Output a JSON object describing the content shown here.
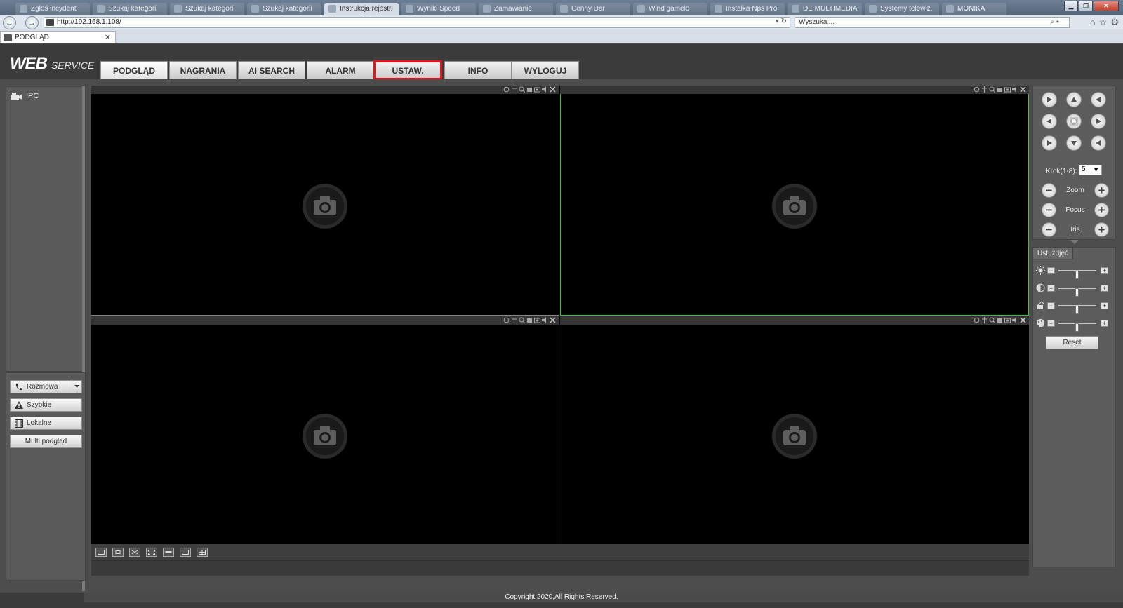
{
  "browser": {
    "tabs": [
      "Zgłoś incydent",
      "Szukaj kategorii",
      "Szukaj kategorii",
      "Szukaj kategorii",
      "Instrukcja rejestr.",
      "Wyniki Speed",
      "Zamawianie",
      "Cenny Dar",
      "Wind gamelo",
      "Instalka Nps Pro",
      "DE MULTIMEDIA",
      "Systemy telewiz.",
      "MONIKA"
    ],
    "url": "http://192.168.1.108/",
    "search_placeholder": "Wyszukaj...",
    "page_tab": "PODGLĄD"
  },
  "header": {
    "logo_main": "WEB",
    "logo_sub": "SERVICE",
    "tabs": [
      {
        "label": "PODGLĄD"
      },
      {
        "label": "NAGRANIA"
      },
      {
        "label": "AI SEARCH"
      },
      {
        "label": "ALARM"
      },
      {
        "label": "USTAW."
      },
      {
        "label": "INFO"
      },
      {
        "label": "WYLOGUJ"
      }
    ],
    "active_tab": "PODGLĄD",
    "highlighted_tab": "USTAW."
  },
  "sidebar": {
    "device": "IPC",
    "buttons": {
      "talk": "Rozmowa",
      "quick": "Szybkie",
      "local": "Lokalne",
      "multi": "Multi podgląd"
    }
  },
  "ptz": {
    "step_label": "Krok(1-8):",
    "step_value": "5",
    "zoom": "Zoom",
    "focus": "Focus",
    "iris": "Iris"
  },
  "image_settings": {
    "tab": "Ust. zdjęć",
    "sliders": [
      {
        "icon": "brightness-icon",
        "value": 0.5
      },
      {
        "icon": "contrast-icon",
        "value": 0.5
      },
      {
        "icon": "saturation-icon",
        "value": 0.5
      },
      {
        "icon": "hue-icon",
        "value": 0.5
      }
    ],
    "reset": "Reset"
  },
  "colors": {
    "selected_cell": "#36c53f",
    "highlight": "#e0151c"
  },
  "footer": {
    "copyright": "Copyright 2020,All Rights Reserved."
  }
}
